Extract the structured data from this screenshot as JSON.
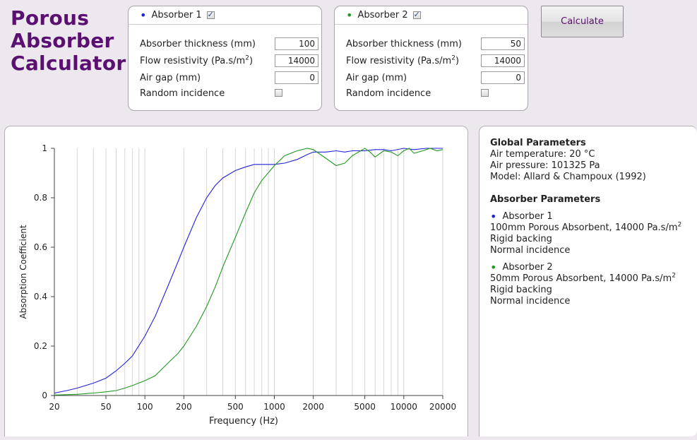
{
  "app": {
    "title_lines": [
      "Porous",
      "Absorber",
      "Calculator"
    ]
  },
  "colors": {
    "absorber1": "#2222dd",
    "absorber2": "#229922",
    "title": "#5a1070"
  },
  "absorber1": {
    "name": "Absorber 1",
    "enabled": true,
    "thickness_label": "Absorber thickness (mm)",
    "thickness": "100",
    "flow_label_pre": "Flow resistivity (Pa.s/m",
    "flow_label_sup": "2",
    "flow_label_post": ")",
    "flow": "14000",
    "airgap_label": "Air gap (mm)",
    "airgap": "0",
    "random_label": "Random incidence",
    "random": false
  },
  "absorber2": {
    "name": "Absorber 2",
    "enabled": true,
    "thickness_label": "Absorber thickness (mm)",
    "thickness": "50",
    "flow_label_pre": "Flow resistivity (Pa.s/m",
    "flow_label_sup": "2",
    "flow_label_post": ")",
    "flow": "14000",
    "airgap_label": "Air gap (mm)",
    "airgap": "0",
    "random_label": "Random incidence",
    "random": false
  },
  "calculate_label": "Calculate",
  "info": {
    "global_header": "Global Parameters",
    "air_temperature": "Air temperature: 20 °C",
    "air_pressure": "Air pressure: 101325 Pa",
    "model": "Model: Allard & Champoux (1992)",
    "absorber_header": "Absorber Parameters",
    "a1_name": "Absorber 1",
    "a1_desc_pre": "100mm Porous Absorbent, 14000 Pa.s/m",
    "a1_desc_sup": "2",
    "a1_backing": "Rigid backing",
    "a1_incidence": "Normal incidence",
    "a2_name": "Absorber 2",
    "a2_desc_pre": "50mm Porous Absorbent, 14000 Pa.s/m",
    "a2_desc_sup": "2",
    "a2_backing": "Rigid backing",
    "a2_incidence": "Normal incidence"
  },
  "chart_data": {
    "type": "line",
    "xlabel": "Frequency (Hz)",
    "ylabel": "Absorption Coefficient",
    "x_scale": "log",
    "xlim": [
      20,
      20000
    ],
    "ylim": [
      0,
      1
    ],
    "x_ticks": [
      20,
      50,
      100,
      200,
      500,
      1000,
      2000,
      5000,
      10000,
      20000
    ],
    "x_tick_labels": [
      "20",
      "50",
      "100",
      "200",
      "500",
      "1000",
      "2000",
      "5000",
      "10000",
      "20000"
    ],
    "y_ticks": [
      0,
      0.2,
      0.4,
      0.6,
      0.8,
      1
    ],
    "y_tick_labels": [
      "0",
      "0.2",
      "0.4",
      "0.6",
      "0.8",
      "1"
    ],
    "grid": "vertical",
    "series": [
      {
        "color": "#2222dd",
        "x": [
          20,
          25,
          30,
          40,
          50,
          60,
          70,
          80,
          100,
          120,
          150,
          180,
          200,
          250,
          300,
          350,
          400,
          500,
          600,
          700,
          800,
          1000,
          1200,
          1500,
          1800,
          2000,
          2500,
          3000,
          3500,
          4000,
          5000,
          6000,
          7000,
          8000,
          10000,
          12000,
          15000,
          20000
        ],
        "y": [
          0.01,
          0.02,
          0.03,
          0.05,
          0.07,
          0.1,
          0.13,
          0.16,
          0.24,
          0.32,
          0.44,
          0.54,
          0.6,
          0.72,
          0.8,
          0.85,
          0.88,
          0.91,
          0.925,
          0.935,
          0.935,
          0.935,
          0.94,
          0.955,
          0.975,
          0.985,
          0.985,
          0.99,
          0.985,
          0.99,
          0.99,
          0.995,
          0.995,
          0.99,
          1.0,
          0.995,
          1.0,
          1.0
        ]
      },
      {
        "color": "#229922",
        "x": [
          20,
          30,
          40,
          50,
          60,
          70,
          80,
          100,
          120,
          150,
          180,
          200,
          250,
          300,
          350,
          400,
          500,
          600,
          700,
          800,
          1000,
          1200,
          1500,
          1800,
          2000,
          2500,
          3000,
          3500,
          4000,
          5000,
          5500,
          6000,
          7000,
          8000,
          9000,
          10000,
          11000,
          12000,
          14000,
          16000,
          18000,
          20000
        ],
        "y": [
          0.002,
          0.005,
          0.01,
          0.015,
          0.02,
          0.03,
          0.04,
          0.06,
          0.08,
          0.13,
          0.17,
          0.2,
          0.28,
          0.36,
          0.44,
          0.52,
          0.64,
          0.74,
          0.82,
          0.87,
          0.93,
          0.97,
          0.99,
          1.0,
          0.995,
          0.96,
          0.93,
          0.94,
          0.97,
          1.0,
          0.985,
          0.965,
          0.99,
          0.985,
          0.97,
          0.99,
          1.0,
          0.98,
          0.99,
          1.0,
          0.99,
          0.995
        ]
      }
    ]
  }
}
